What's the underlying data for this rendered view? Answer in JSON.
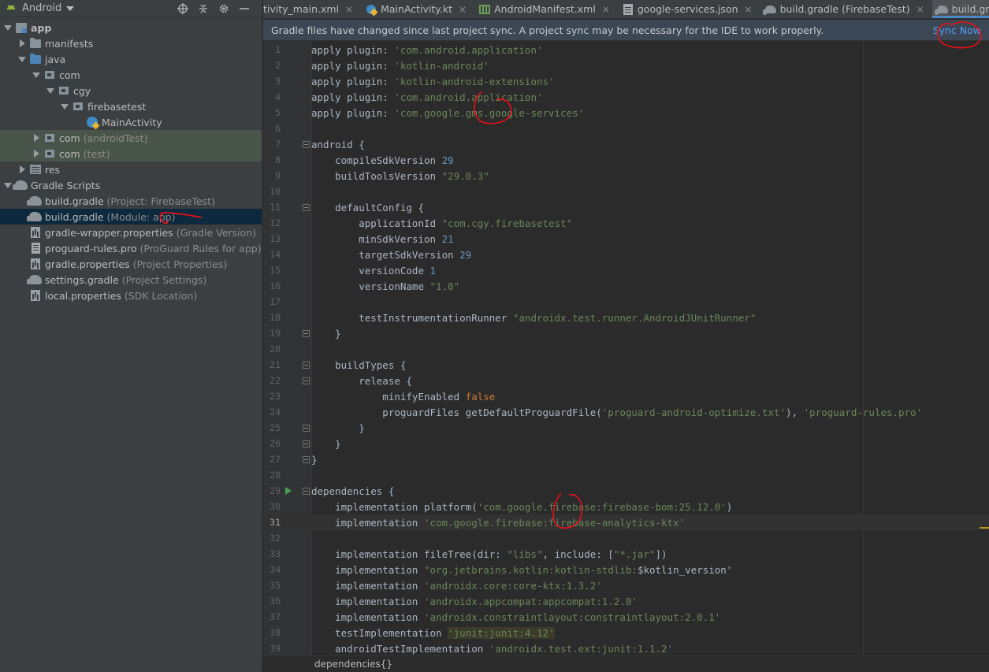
{
  "project_panel": {
    "view_label": "Android",
    "tree": [
      {
        "name": "app",
        "hint": "",
        "indent": 0,
        "arrow": "down",
        "icon": "module-icon",
        "bold": true
      },
      {
        "name": "manifests",
        "hint": "",
        "indent": 1,
        "arrow": "right",
        "icon": "folder-icon"
      },
      {
        "name": "java",
        "hint": "",
        "indent": 1,
        "arrow": "down",
        "icon": "folder-blue-icon"
      },
      {
        "name": "com",
        "hint": "",
        "indent": 2,
        "arrow": "down",
        "icon": "package-icon"
      },
      {
        "name": "cgy",
        "hint": "",
        "indent": 3,
        "arrow": "down",
        "icon": "package-icon"
      },
      {
        "name": "firebasetest",
        "hint": "",
        "indent": 4,
        "arrow": "down",
        "icon": "package-icon"
      },
      {
        "name": "MainActivity",
        "hint": "",
        "indent": 5,
        "arrow": "none",
        "icon": "kotlin-file-icon"
      },
      {
        "name": "com",
        "hint": "(androidTest)",
        "indent": 2,
        "arrow": "right",
        "icon": "package-icon",
        "test": true
      },
      {
        "name": "com",
        "hint": "(test)",
        "indent": 2,
        "arrow": "right",
        "icon": "package-icon",
        "test": true
      },
      {
        "name": "res",
        "hint": "",
        "indent": 1,
        "arrow": "right",
        "icon": "res-folder-icon"
      },
      {
        "name": "Gradle Scripts",
        "hint": "",
        "indent": 0,
        "arrow": "down",
        "icon": "gradle-icon"
      },
      {
        "name": "build.gradle",
        "hint": "(Project: FirebaseTest)",
        "indent": 1,
        "arrow": "none",
        "icon": "gradle-icon"
      },
      {
        "name": "build.gradle",
        "hint": "(Module: app)",
        "indent": 1,
        "arrow": "none",
        "icon": "gradle-icon",
        "selected": true
      },
      {
        "name": "gradle-wrapper.properties",
        "hint": "(Gradle Version)",
        "indent": 1,
        "arrow": "none",
        "icon": "properties-icon"
      },
      {
        "name": "proguard-rules.pro",
        "hint": "(ProGuard Rules for app)",
        "indent": 1,
        "arrow": "none",
        "icon": "text-file-icon"
      },
      {
        "name": "gradle.properties",
        "hint": "(Project Properties)",
        "indent": 1,
        "arrow": "none",
        "icon": "properties-icon"
      },
      {
        "name": "settings.gradle",
        "hint": "(Project Settings)",
        "indent": 1,
        "arrow": "none",
        "icon": "gradle-icon"
      },
      {
        "name": "local.properties",
        "hint": "(SDK Location)",
        "indent": 1,
        "arrow": "none",
        "icon": "properties-icon"
      }
    ]
  },
  "tabs": [
    {
      "label": "tivity_main.xml",
      "icon": "none",
      "active": false
    },
    {
      "label": "MainActivity.kt",
      "icon": "kotlin-file-icon",
      "active": false
    },
    {
      "label": "AndroidManifest.xml",
      "icon": "manifest-icon",
      "active": false
    },
    {
      "label": "google-services.json",
      "icon": "json-file-icon",
      "active": false
    },
    {
      "label": "build.gradle (FirebaseTest)",
      "icon": "gradle-icon",
      "active": false
    },
    {
      "label": "build.gradle (:app)",
      "icon": "gradle-icon",
      "active": true
    }
  ],
  "tab_overflow": "≡",
  "notification": {
    "message": "Gradle files have changed since last project sync. A project sync may be necessary for the IDE to work properly.",
    "action": "Sync Now"
  },
  "code": {
    "current_line": 31,
    "lines": [
      {
        "n": "1",
        "segs": [
          [
            "p",
            "apply plugin: "
          ],
          [
            "s",
            "'com.android.application'"
          ]
        ]
      },
      {
        "n": "2",
        "segs": [
          [
            "p",
            "apply plugin: "
          ],
          [
            "s",
            "'kotlin-android'"
          ]
        ]
      },
      {
        "n": "3",
        "segs": [
          [
            "p",
            "apply plugin: "
          ],
          [
            "s",
            "'kotlin-android-extensions'"
          ]
        ]
      },
      {
        "n": "4",
        "segs": [
          [
            "p",
            "apply plugin: "
          ],
          [
            "s",
            "'com.android.application'"
          ]
        ]
      },
      {
        "n": "5",
        "segs": [
          [
            "p",
            "apply plugin: "
          ],
          [
            "s",
            "'com.google.gms.google-services'"
          ]
        ]
      },
      {
        "n": "6",
        "segs": []
      },
      {
        "n": "7",
        "segs": [
          [
            "p",
            "android {"
          ]
        ],
        "fold": "start"
      },
      {
        "n": "8",
        "segs": [
          [
            "p",
            "    compileSdkVersion "
          ],
          [
            "n",
            "29"
          ]
        ]
      },
      {
        "n": "9",
        "segs": [
          [
            "p",
            "    buildToolsVersion "
          ],
          [
            "s",
            "\"29.0.3\""
          ]
        ]
      },
      {
        "n": "10",
        "segs": []
      },
      {
        "n": "11",
        "segs": [
          [
            "p",
            "    defaultConfig {"
          ]
        ],
        "fold": "start"
      },
      {
        "n": "12",
        "segs": [
          [
            "p",
            "        applicationId "
          ],
          [
            "s",
            "\"com.cgy.firebasetest\""
          ]
        ]
      },
      {
        "n": "13",
        "segs": [
          [
            "p",
            "        minSdkVersion "
          ],
          [
            "n",
            "21"
          ]
        ]
      },
      {
        "n": "14",
        "segs": [
          [
            "p",
            "        targetSdkVersion "
          ],
          [
            "n",
            "29"
          ]
        ]
      },
      {
        "n": "15",
        "segs": [
          [
            "p",
            "        versionCode "
          ],
          [
            "n",
            "1"
          ]
        ]
      },
      {
        "n": "16",
        "segs": [
          [
            "p",
            "        versionName "
          ],
          [
            "s",
            "\"1.0\""
          ]
        ]
      },
      {
        "n": "17",
        "segs": []
      },
      {
        "n": "18",
        "segs": [
          [
            "p",
            "        testInstrumentationRunner "
          ],
          [
            "s",
            "\"androidx.test.runner.AndroidJUnitRunner\""
          ]
        ]
      },
      {
        "n": "19",
        "segs": [
          [
            "p",
            "    }"
          ]
        ],
        "fold": "end"
      },
      {
        "n": "20",
        "segs": []
      },
      {
        "n": "21",
        "segs": [
          [
            "p",
            "    buildTypes {"
          ]
        ],
        "fold": "start"
      },
      {
        "n": "22",
        "segs": [
          [
            "p",
            "        release {"
          ]
        ],
        "fold": "start"
      },
      {
        "n": "23",
        "segs": [
          [
            "p",
            "            minifyEnabled "
          ],
          [
            "k",
            "false"
          ]
        ]
      },
      {
        "n": "24",
        "segs": [
          [
            "p",
            "            proguardFiles getDefaultProguardFile("
          ],
          [
            "s",
            "'proguard-android-optimize.txt'"
          ],
          [
            "p",
            "), "
          ],
          [
            "s",
            "'proguard-rules.pro'"
          ]
        ]
      },
      {
        "n": "25",
        "segs": [
          [
            "p",
            "        }"
          ]
        ],
        "fold": "end"
      },
      {
        "n": "26",
        "segs": [
          [
            "p",
            "    }"
          ]
        ],
        "fold": "end"
      },
      {
        "n": "27",
        "segs": [
          [
            "p",
            "}"
          ]
        ],
        "fold": "end"
      },
      {
        "n": "28",
        "segs": []
      },
      {
        "n": "29",
        "segs": [
          [
            "p",
            "dependencies {"
          ]
        ],
        "fold": "start",
        "run": true
      },
      {
        "n": "30",
        "segs": [
          [
            "p",
            "    implementation platform("
          ],
          [
            "s",
            "'com.google.firebase:firebase-bom:25.12.0'"
          ],
          [
            "p",
            ")"
          ]
        ]
      },
      {
        "n": "31",
        "segs": [
          [
            "p",
            "    implementation "
          ],
          [
            "s",
            "'com.google.firebase:firebase-analytics-ktx'"
          ]
        ]
      },
      {
        "n": "32",
        "segs": []
      },
      {
        "n": "33",
        "segs": [
          [
            "p",
            "    implementation fileTree(dir: "
          ],
          [
            "s",
            "\"libs\""
          ],
          [
            "p",
            ", include: ["
          ],
          [
            "s",
            "\"*.jar\""
          ],
          [
            "p",
            "])"
          ]
        ]
      },
      {
        "n": "34",
        "segs": [
          [
            "p",
            "    implementation "
          ],
          [
            "s",
            "\"org.jetbrains.kotlin:kotlin-stdlib:"
          ],
          [
            "p",
            "$kotlin_version"
          ],
          [
            "s",
            "\""
          ]
        ]
      },
      {
        "n": "35",
        "segs": [
          [
            "p",
            "    implementation "
          ],
          [
            "s",
            "'androidx.core:core-ktx:1.3.2'"
          ]
        ]
      },
      {
        "n": "36",
        "segs": [
          [
            "p",
            "    implementation "
          ],
          [
            "s",
            "'androidx.appcompat:appcompat:1.2.0'"
          ]
        ]
      },
      {
        "n": "37",
        "segs": [
          [
            "p",
            "    implementation "
          ],
          [
            "s",
            "'androidx.constraintlayout:constraintlayout:2.0.1'"
          ]
        ]
      },
      {
        "n": "38",
        "segs": [
          [
            "p",
            "    testImplementation "
          ],
          [
            "h",
            "'junit:junit:4.12'"
          ]
        ]
      },
      {
        "n": "39",
        "segs": [
          [
            "p",
            "    androidTestImplementation "
          ],
          [
            "s",
            "'androidx.test.ext:junit:1.1.2'"
          ]
        ]
      }
    ]
  },
  "breadcrumb": "dependencies{}",
  "colors": {
    "annotation_red": "#e8101a",
    "accent_blue": "#4a88c7",
    "link": "#589df6"
  }
}
